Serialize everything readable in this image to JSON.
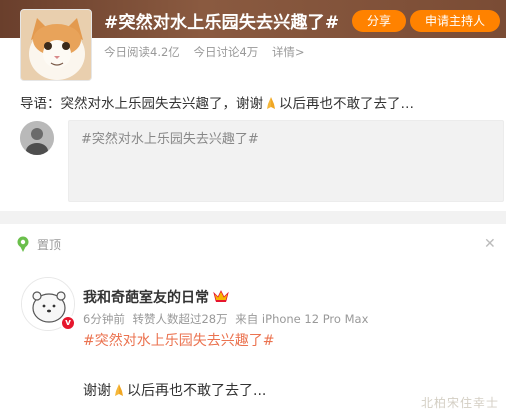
{
  "topic": {
    "title": "#突然对水上乐园失去兴趣了#",
    "share_label": "分享",
    "host_label": "申请主持人",
    "reads": "今日阅读4.2亿",
    "discussions": "今日讨论4万",
    "details": "详情>",
    "guide_label": "导语：",
    "guide_before": "突然对水上乐园失去兴趣了，谢谢",
    "guide_after": "以后再也不敢了去了…"
  },
  "composer": {
    "text": "#突然对水上乐园失去兴趣了#"
  },
  "post": {
    "pin_label": "置顶",
    "close_symbol": "✕",
    "username": "我和奇葩室友的日常",
    "verify": "v",
    "time": "6分钟前",
    "reposts": "转赞人数超过28万",
    "source": "来自 iPhone 12 Pro Max",
    "tag": "#突然对水上乐园失去兴趣了#",
    "body_before": "谢谢",
    "body_after": "以后再也不敢了去了..."
  },
  "watermark": "北柏宋住幸士",
  "colors": {
    "accent": "#ff8200",
    "tag": "#eb7350",
    "verify": "#e6162d",
    "pin": "#6abf4b"
  },
  "icons": [
    "cat-avatar",
    "pray-hands-icon",
    "pin-icon",
    "crown-icon",
    "bear-avatar",
    "close-icon"
  ]
}
